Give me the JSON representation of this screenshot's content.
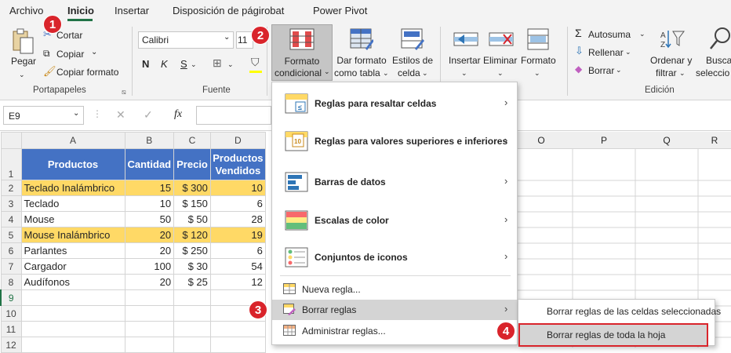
{
  "tabs": [
    "Archivo",
    "Inicio",
    "Insertar",
    "Disposición de págirobat",
    "Power Pivot"
  ],
  "badges": [
    "1",
    "2",
    "3",
    "4"
  ],
  "clipboard": {
    "paste": "Pegar",
    "cut": "Cortar",
    "copy": "Copiar",
    "format_painter": "Copiar formato",
    "group": "Portapapeles"
  },
  "font": {
    "name": "Calibri",
    "size": "11",
    "bold": "N",
    "italic": "K",
    "underline": "S",
    "group": "Fuente"
  },
  "styles": {
    "cond_format_line1": "Formato",
    "cond_format_line2": "condicional",
    "table_format_line1": "Dar formato",
    "table_format_line2": "como tabla",
    "cell_styles_line1": "Estilos de",
    "cell_styles_line2": "celda"
  },
  "cells": {
    "insert": "Insertar",
    "delete": "Eliminar",
    "format": "Formato"
  },
  "editing": {
    "autosum": "Autosuma",
    "fill": "Rellenar",
    "clear": "Borrar",
    "sort_line1": "Ordenar y",
    "sort_line2": "filtrar",
    "search_line1": "Busca",
    "search_line2": "seleccio",
    "group": "Edición"
  },
  "formula_bar": {
    "name_box": "E9",
    "fx": "fx"
  },
  "columns": [
    "A",
    "B",
    "C",
    "D",
    "O",
    "P",
    "Q",
    "R"
  ],
  "table": {
    "headers": [
      "Productos",
      "Cantidad",
      "Precio",
      "Productos Vendidos"
    ],
    "rows": [
      [
        "Teclado Inalámbrico",
        "15",
        "$ 300",
        "10"
      ],
      [
        "Teclado",
        "10",
        "$ 150",
        "6"
      ],
      [
        "Mouse",
        "50",
        "$ 50",
        "28"
      ],
      [
        "Mouse Inalámbrico",
        "20",
        "$ 120",
        "19"
      ],
      [
        "Parlantes",
        "20",
        "$ 250",
        "6"
      ],
      [
        "Cargador",
        "100",
        "$ 30",
        "54"
      ],
      [
        "Audífonos",
        "20",
        "$ 25",
        "12"
      ]
    ],
    "row_numbers": [
      "1",
      "2",
      "3",
      "4",
      "5",
      "6",
      "7",
      "8",
      "9",
      "10",
      "11",
      "12"
    ]
  },
  "menu": {
    "items": [
      "Reglas para resaltar celdas",
      "Reglas para valores superiores e inferiores",
      "Barras de datos",
      "Escalas de color",
      "Conjuntos de iconos"
    ],
    "new_rule": "Nueva regla...",
    "clear_rules": "Borrar reglas",
    "manage_rules": "Administrar reglas..."
  },
  "submenu": {
    "clear_selected": "Borrar reglas de las celdas seleccionadas",
    "clear_sheet": "Borrar reglas de toda la hoja"
  },
  "colors": {
    "header_blue": "#4472c4",
    "highlight_yellow": "#ffd966",
    "excel_green": "#217346",
    "badge_red": "#d9242b"
  }
}
